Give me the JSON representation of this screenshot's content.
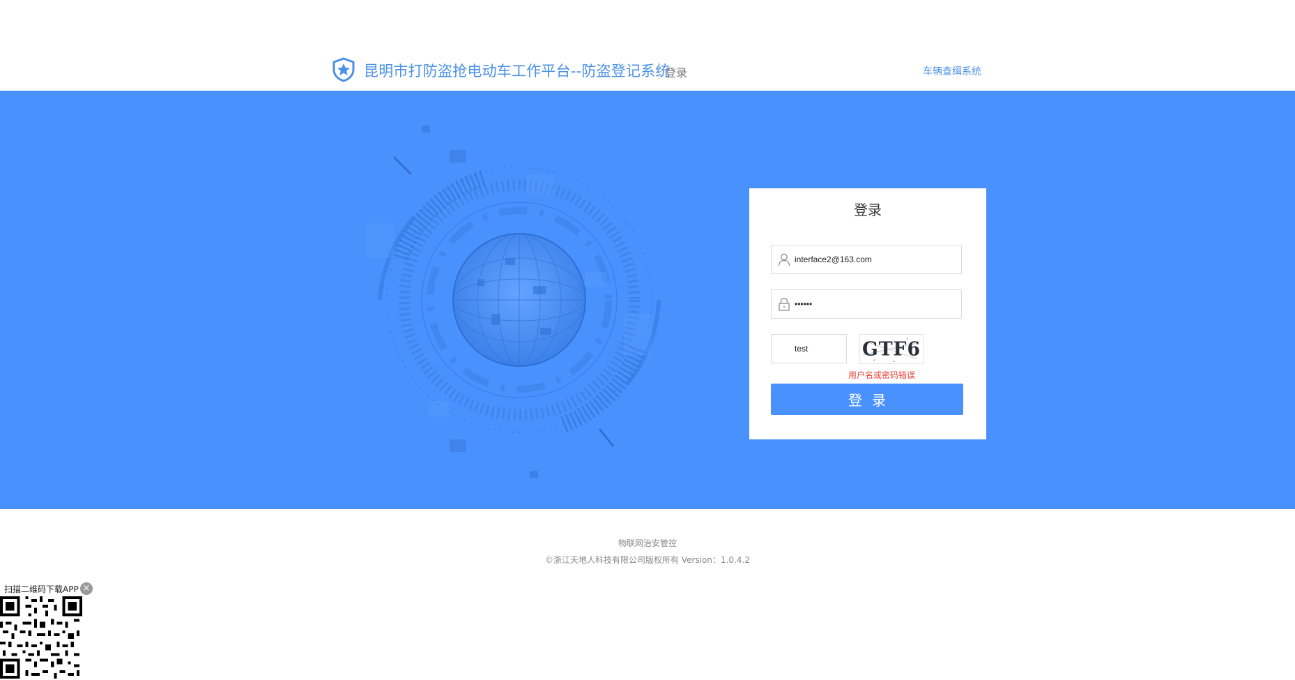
{
  "header": {
    "app_title": "昆明市打防盗抢电动车工作平台--防盗登记系统",
    "page_label": "登录",
    "nav_link": "车辆查缉系统"
  },
  "login": {
    "title": "登录",
    "username_value": "interface2@163.com",
    "password_value": "••••••",
    "captcha_value": "test",
    "captcha_image_text": "GTF6",
    "error_message": "用户名或密码错误",
    "submit_label": "登录"
  },
  "footer": {
    "line1": "物联网治安管控",
    "line2": "©浙江天地人科技有限公司版权所有 Version：1.0.4.2"
  },
  "qr": {
    "label": "扫描二维码下载APP",
    "close_glyph": "×"
  },
  "colors": {
    "brand_blue": "#4992fd",
    "title_blue": "#4a90e8",
    "error_red": "#e8413a"
  },
  "icons": [
    "shield-star-icon",
    "user-icon",
    "lock-icon",
    "close-icon",
    "qr-code-icon"
  ]
}
